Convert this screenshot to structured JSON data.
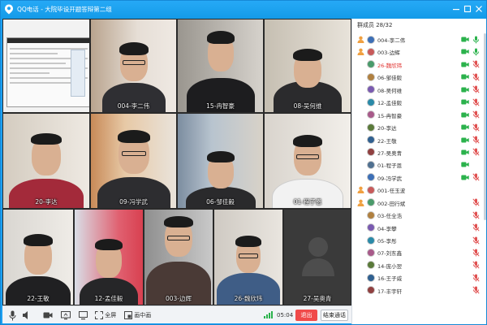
{
  "window": {
    "title": "QQ电话 - 大院毕设开题答辩第二组",
    "controls": [
      "minimize-icon",
      "maximize-icon",
      "close-icon"
    ]
  },
  "grid": {
    "tiles": [
      {
        "label": ""
      },
      {
        "label": "004-李二伟"
      },
      {
        "label": "15-冉智豪"
      },
      {
        "label": "08-吴何维"
      },
      {
        "label": "20-李达"
      },
      {
        "label": "09-冯学武"
      },
      {
        "label": "06-邹佳毅"
      },
      {
        "label": "01-程子恩"
      },
      {
        "label": "22-王敬"
      },
      {
        "label": "12-孟佳毅"
      },
      {
        "label": "003-边辉"
      },
      {
        "label": "26-魏欣玮"
      },
      {
        "label": "27-吴奥青"
      }
    ]
  },
  "toolbar": {
    "mic": "microphone-icon",
    "speaker": "speaker-icon",
    "camera": "camera-icon",
    "share": "share-screen-icon",
    "display": "display-icon",
    "fullscreen_label": "全屏",
    "pip_label": "画中画",
    "timer": "05:04",
    "exit_label": "退出",
    "end_label": "结束通话"
  },
  "panel": {
    "header": "群成员 28/32",
    "members": [
      {
        "name": "004-李二伟",
        "role": "admin",
        "cam": "on",
        "mic": "on",
        "highlight": false
      },
      {
        "name": "003-边辉",
        "role": "admin",
        "cam": "on",
        "mic": "on",
        "highlight": false
      },
      {
        "name": "26-魏欣玮",
        "role": "",
        "cam": "on",
        "mic": "muted",
        "highlight": true
      },
      {
        "name": "06-邹佳毅",
        "role": "",
        "cam": "on",
        "mic": "muted",
        "highlight": false
      },
      {
        "name": "08-吴何维",
        "role": "",
        "cam": "on",
        "mic": "muted",
        "highlight": false
      },
      {
        "name": "12-孟佳毅",
        "role": "",
        "cam": "on",
        "mic": "muted",
        "highlight": false
      },
      {
        "name": "15-冉智豪",
        "role": "",
        "cam": "on",
        "mic": "muted",
        "highlight": false
      },
      {
        "name": "20-李达",
        "role": "",
        "cam": "on",
        "mic": "muted",
        "highlight": false
      },
      {
        "name": "22-王敬",
        "role": "",
        "cam": "on",
        "mic": "muted",
        "highlight": false
      },
      {
        "name": "27-吴奥青",
        "role": "",
        "cam": "on",
        "mic": "muted",
        "highlight": false
      },
      {
        "name": "01-程子恩",
        "role": "",
        "cam": "on",
        "mic": "",
        "highlight": false
      },
      {
        "name": "09-冯学武",
        "role": "",
        "cam": "on",
        "mic": "muted",
        "highlight": false
      },
      {
        "name": "001-任玉波",
        "role": "admin",
        "cam": "",
        "mic": "",
        "highlight": false
      },
      {
        "name": "002-田行斌",
        "role": "admin",
        "cam": "",
        "mic": "muted",
        "highlight": false
      },
      {
        "name": "03-任全浩",
        "role": "",
        "cam": "",
        "mic": "muted",
        "highlight": false
      },
      {
        "name": "04-李攀",
        "role": "",
        "cam": "",
        "mic": "muted",
        "highlight": false
      },
      {
        "name": "05-李彤",
        "role": "",
        "cam": "",
        "mic": "muted",
        "highlight": false
      },
      {
        "name": "07-刘东鑫",
        "role": "",
        "cam": "",
        "mic": "muted",
        "highlight": false
      },
      {
        "name": "14-庞小翌",
        "role": "",
        "cam": "",
        "mic": "muted",
        "highlight": false
      },
      {
        "name": "16-王子威",
        "role": "",
        "cam": "",
        "mic": "muted",
        "highlight": false
      },
      {
        "name": "17-丰宇轩",
        "role": "",
        "cam": "",
        "mic": "muted",
        "highlight": false
      }
    ]
  },
  "colors": {
    "titlebar": "#1ca0f2",
    "exit_button": "#f04a4a",
    "mic_on": "#2bb24c",
    "muted": "#e05050",
    "highlight_name": "#e0302d"
  }
}
